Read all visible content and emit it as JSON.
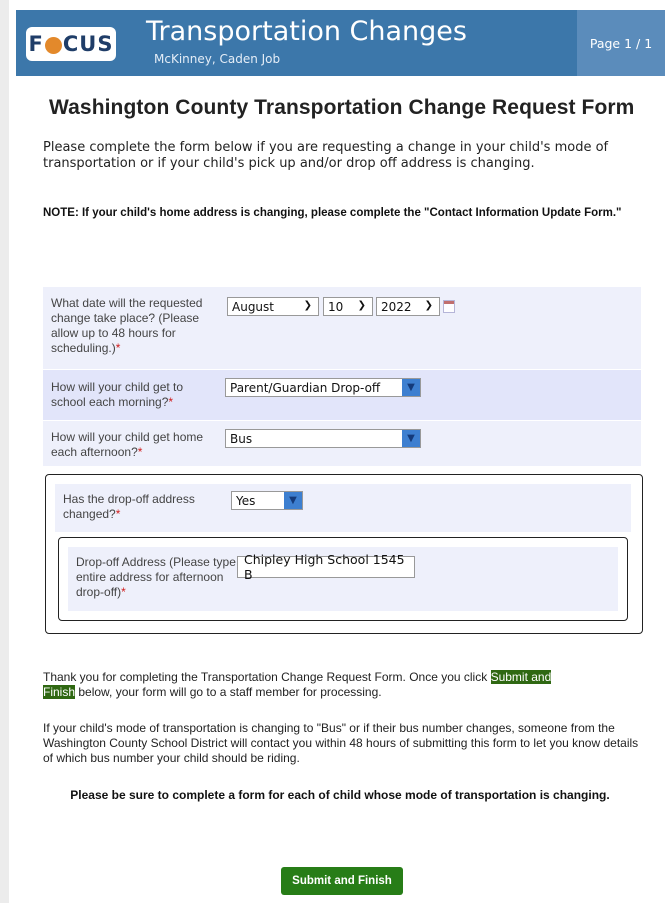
{
  "header": {
    "logo": {
      "pre": "F",
      "post": "CUS"
    },
    "title": "Transportation Changes",
    "student": "McKinney, Caden Job",
    "page": "Page 1 / 1"
  },
  "form": {
    "title": "Washington County Transportation Change Request Form",
    "intro": "Please complete the form below if you are requesting a change in your child's mode of transportation or if your child's pick up and/or drop off address is changing.",
    "note": "NOTE: If your child's home address is changing, please complete the \"Contact Information Update Form.\"",
    "date_question": {
      "label": "What date will the requested change take place? (Please allow up to 48 hours for scheduling.)",
      "month": "August",
      "day": "10",
      "year": "2022"
    },
    "morning_question": {
      "label": "How will your child get to school each morning?",
      "value": "Parent/Guardian Drop-off"
    },
    "afternoon_question": {
      "label": "How will your child get home each afternoon?",
      "value": "Bus"
    },
    "dropoff_changed": {
      "label": "Has the drop-off address changed?",
      "value": "Yes"
    },
    "dropoff_address": {
      "label": "Drop-off Address (Please type entire address for afternoon drop-off)",
      "value": "Chipley High School 1545 B"
    },
    "required_marker": "*",
    "thanks": {
      "before": "Thank you for completing the Transportation Change Request Form.  Once you click ",
      "highlight1": "Submit and",
      "highlight2": "Finish",
      "after": " below, your form will go to a staff member for processing."
    },
    "bus_info": "If your child's mode of transportation is changing to \"Bus\" or if their bus number changes, someone from the Washington County School District will contact you within 48 hours of submitting this form to let you know details of which bus number your child should be riding.",
    "reminder": "Please be sure to complete a form for each of child whose mode of transportation is changing.",
    "submit_label": "Submit and Finish"
  },
  "colors": {
    "header_bg": "#3c77aa",
    "accent_green": "#277d17",
    "row_bg": "#eef0fb",
    "row_bg_alt": "#e2e5fa"
  },
  "icons": [
    "calendar-icon",
    "dropdown-arrow-icon",
    "chevron-down-icon"
  ]
}
